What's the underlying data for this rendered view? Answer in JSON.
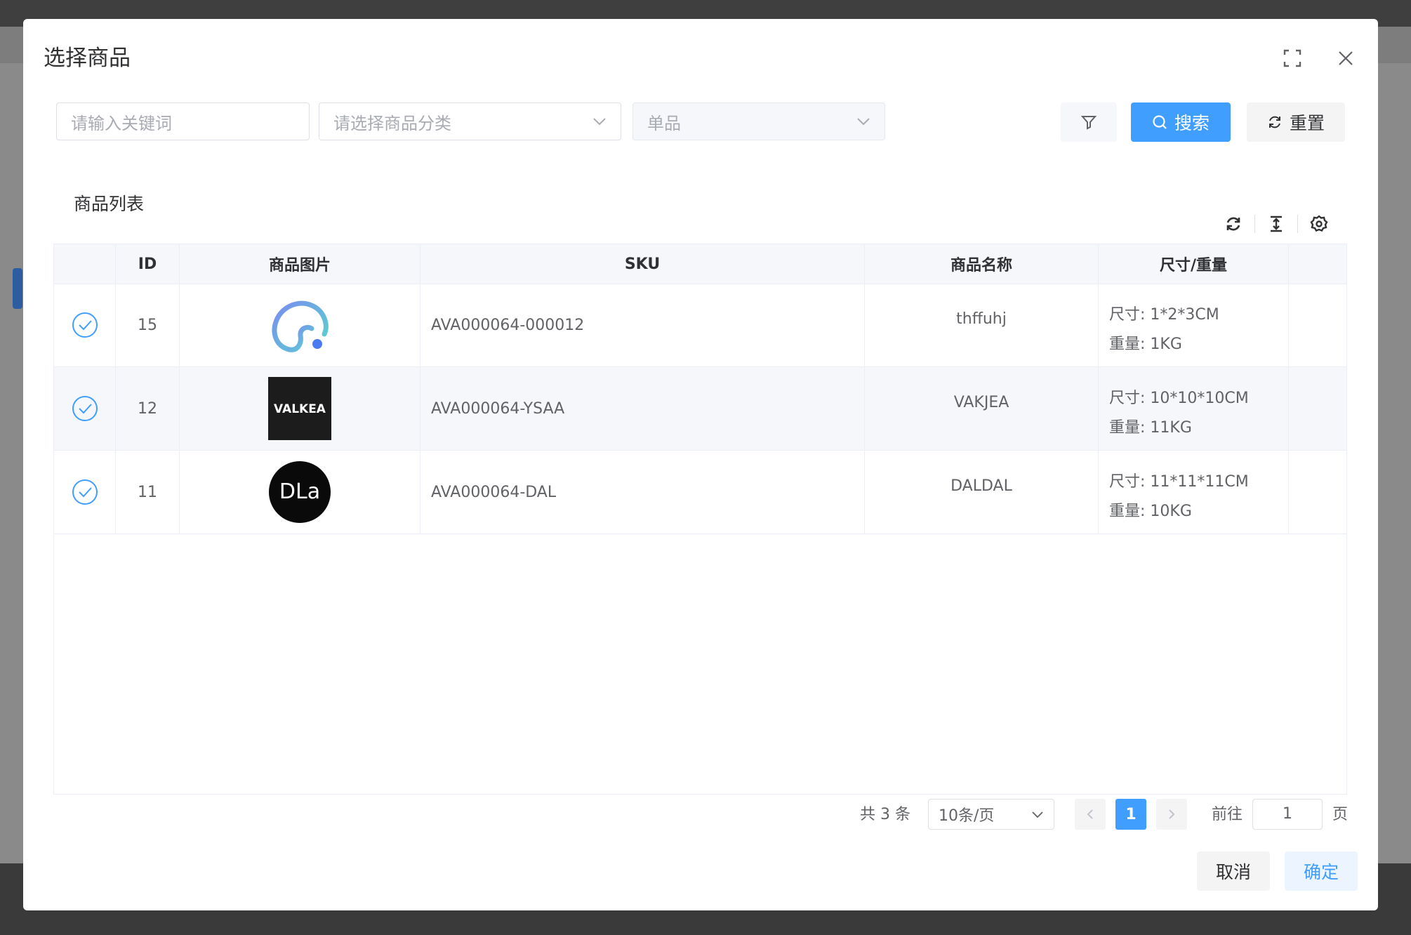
{
  "dialog": {
    "title": "选择商品",
    "fullscreen_icon": "fullscreen-icon",
    "close_icon": "close-icon"
  },
  "search": {
    "keyword_placeholder": "请输入关键词",
    "category_placeholder": "请选择商品分类",
    "type_value": "单品",
    "search_label": "搜索",
    "reset_label": "重置"
  },
  "list": {
    "title": "商品列表",
    "tools": [
      "refresh-icon",
      "column-height-icon",
      "settings-icon"
    ]
  },
  "table": {
    "headers": {
      "id": "ID",
      "image": "商品图片",
      "sku": "SKU",
      "name": "商品名称",
      "size_weight": "尺寸/重量"
    },
    "rows": [
      {
        "selected": true,
        "id": "15",
        "image": "swirl-logo",
        "sku": "AVA000064-000012",
        "name": "thffuhj",
        "size": "尺寸: 1*2*3CM",
        "weight": "重量: 1KG"
      },
      {
        "selected": true,
        "id": "12",
        "image": "valkea-logo",
        "image_text": "VALKEA",
        "sku": "AVA000064-YSAA",
        "name": "VAKJEA",
        "size": "尺寸: 10*10*10CM",
        "weight": "重量: 11KG"
      },
      {
        "selected": true,
        "id": "11",
        "image": "dla-logo",
        "image_text": "DLa",
        "sku": "AVA000064-DAL",
        "name": "DALDAL",
        "size": "尺寸: 11*11*11CM",
        "weight": "重量: 10KG"
      }
    ]
  },
  "pagination": {
    "total": "共 3 条",
    "page_size": "10条/页",
    "current_page": "1",
    "goto_label": "前往",
    "goto_value": "1",
    "goto_suffix": "页"
  },
  "footer": {
    "cancel_label": "取消",
    "confirm_label": "确定"
  },
  "colors": {
    "primary": "#409eff",
    "overlay": "#7d7d7d",
    "border": "#ebeef5"
  }
}
